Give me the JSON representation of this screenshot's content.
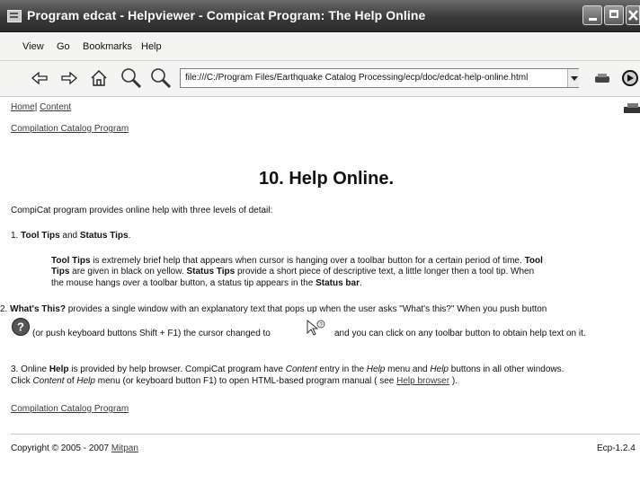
{
  "window": {
    "title": "Program edcat - Helpviewer - Compicat Program: The Help Online",
    "min_icon": "minimize-icon",
    "max_icon": "maximize-icon",
    "close_icon": "close-icon"
  },
  "menu": {
    "items": [
      "View",
      "Go",
      "Bookmarks",
      "Help"
    ]
  },
  "toolbar": {
    "address": "file:///C:/Program Files/Earthquake Catalog Processing/ecp/doc/edcat-help-online.html",
    "icons": [
      "back-arrow-icon",
      "forward-arrow-icon",
      "home-icon",
      "zoom-in-icon",
      "zoom-out-icon",
      "print-icon",
      "reload-icon"
    ]
  },
  "nav": {
    "home": "Home",
    "sep": "|",
    "content": "Content",
    "compilation": "Compilation Catalog Program"
  },
  "page": {
    "heading": "10. Help Online.",
    "intro": "CompiCat program provides online help with three levels of detail:",
    "item1_title_a": "Tool Tips",
    "item1_title_and": " and ",
    "item1_title_b": "Status Tips",
    "item1_title_end": ".",
    "item1_line1_a": "Tool Tips",
    "item1_line1_b": " is extremely brief help that appears when cursor is hanging over a toolbar button for a certain period of time. ",
    "item1_line1_c": "Tool",
    "item1_line2_a": "Tips",
    "item1_line2_b": " are given in black on yellow.  ",
    "item1_line2_c": "Status Tips",
    "item1_line2_d": " provide a short piece of descriptive text, a little longer then a tool tip. When",
    "item1_line3_a": "the mouse hangs over a toolbar button, a status tip appears in the ",
    "item1_line3_b": "Status bar",
    "item1_line3_c": ".",
    "item2_num": "2. ",
    "item2_title": "What's This?",
    "item2_text": " provides a single window with an explanatory text that pops up when the user asks \"What's this?\" When you push button",
    "item2_line2_a": "(or push keyboard buttons Shift + F1) the cursor changed to",
    "item2_line2_b": "and you can click on any toolbar button to obtain help text on it.",
    "item3_num": "3. Online ",
    "item3_title": "Help",
    "item3_a": " is provided by help browser.  CompiCat program have ",
    "item3_content": "Content",
    "item3_b": " entry in the ",
    "item3_help": "Help",
    "item3_c": " menu and ",
    "item3_help2": "Help",
    "item3_d": " buttons in all other windows.",
    "item3_line2_a": "Click ",
    "item3_line2_content": "Content",
    "item3_line2_of": " of ",
    "item3_line2_help": "Help",
    "item3_line2_b": " menu (or keyboard button F1) to open  HTML-based program manual ( see ",
    "item3_line2_link": "Help browser",
    "item3_line2_c": " ).",
    "bottom_link": "Compilation Catalog Program",
    "copyright": "Copyright © 2005 - 2007 ",
    "copyright_link": "Mitpan",
    "version": "Ecp-1.2.4"
  }
}
